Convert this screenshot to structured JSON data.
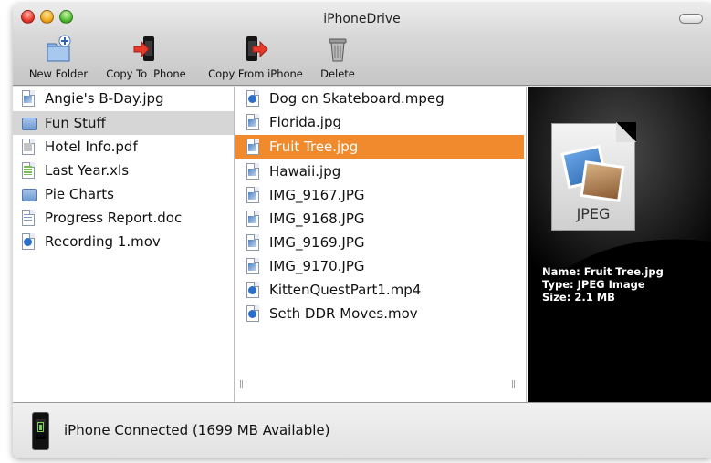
{
  "window": {
    "title": "iPhoneDrive"
  },
  "toolbar": [
    {
      "label": "New Folder",
      "icon": "new-folder-icon"
    },
    {
      "label": "Copy To iPhone",
      "icon": "copy-to-iphone-icon"
    },
    {
      "label": "Copy From iPhone",
      "icon": "copy-from-iphone-icon"
    },
    {
      "label": "Delete",
      "icon": "trash-icon"
    }
  ],
  "column1": {
    "items": [
      {
        "name": "Angie's B-Day.jpg",
        "kind": "image"
      },
      {
        "name": "Fun Stuff",
        "kind": "folder",
        "selected": true
      },
      {
        "name": "Hotel Info.pdf",
        "kind": "pdf"
      },
      {
        "name": "Last Year.xls",
        "kind": "spreadsheet"
      },
      {
        "name": "Pie Charts",
        "kind": "folder"
      },
      {
        "name": "Progress Report.doc",
        "kind": "document"
      },
      {
        "name": "Recording 1.mov",
        "kind": "movie"
      }
    ]
  },
  "column2": {
    "items": [
      {
        "name": "Dog on Skateboard.mpeg",
        "kind": "movie"
      },
      {
        "name": "Florida.jpg",
        "kind": "image"
      },
      {
        "name": "Fruit Tree.jpg",
        "kind": "image",
        "selected": true
      },
      {
        "name": "Hawaii.jpg",
        "kind": "image"
      },
      {
        "name": "IMG_9167.JPG",
        "kind": "image"
      },
      {
        "name": "IMG_9168.JPG",
        "kind": "image"
      },
      {
        "name": "IMG_9169.JPG",
        "kind": "image"
      },
      {
        "name": "IMG_9170.JPG",
        "kind": "image"
      },
      {
        "name": "KittenQuestPart1.mp4",
        "kind": "movie"
      },
      {
        "name": "Seth DDR Moves.mov",
        "kind": "movie"
      }
    ]
  },
  "preview": {
    "icon_label": "JPEG",
    "name_line": "Name: Fruit Tree.jpg",
    "type_line": "Type: JPEG Image",
    "size_line": "Size: 2.1 MB"
  },
  "status": {
    "text": "iPhone Connected (1699 MB Available)"
  },
  "colors": {
    "selection_active": "#f08a2c",
    "selection_inactive": "#d6d6d6"
  }
}
